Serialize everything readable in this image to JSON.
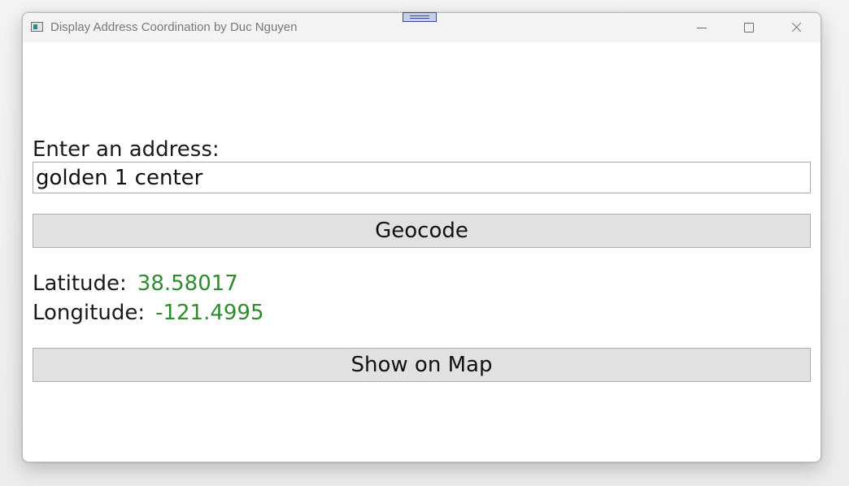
{
  "window": {
    "title": "Display Address Coordination by Duc Nguyen",
    "icon": "app-window-icon",
    "controls": [
      "minimize-icon",
      "maximize-icon",
      "close-icon"
    ]
  },
  "form": {
    "address_label": "Enter an address:",
    "address_value": "golden 1 center",
    "geocode_label": "Geocode",
    "latitude_label": "Latitude:",
    "latitude_value": "38.58017",
    "longitude_label": "Longitude:",
    "longitude_value": "-121.4995",
    "show_map_label": "Show on Map"
  },
  "colors": {
    "coordinate_value": "#2e8b2e",
    "button_background": "#e1e1e1"
  }
}
